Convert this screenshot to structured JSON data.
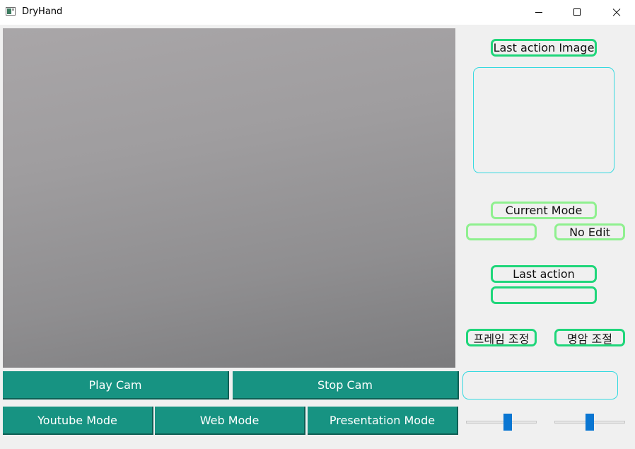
{
  "window": {
    "title": "DryHand"
  },
  "panel": {
    "last_action_image_label": "Last action Image",
    "current_mode_label": "Current Mode",
    "current_mode_value": "",
    "edit_status": "No Edit",
    "last_action_label": "Last action",
    "last_action_value": "",
    "frame_adjust_label": "프레임 조정",
    "brightness_adjust_label": "명암 조절",
    "info_text": ""
  },
  "controls": {
    "play_cam": "Play Cam",
    "stop_cam": "Stop Cam",
    "youtube_mode": "Youtube Mode",
    "web_mode": "Web Mode",
    "presentation_mode": "Presentation Mode"
  },
  "sliders": {
    "frame": {
      "value": 0.6
    },
    "brightness": {
      "value": 0.5
    }
  },
  "colors": {
    "button": "#179382",
    "label_border": "#1fd67a",
    "label_border_light": "#8ff08f",
    "box_border": "#35d9e0",
    "slider_handle": "#0a76d2"
  }
}
